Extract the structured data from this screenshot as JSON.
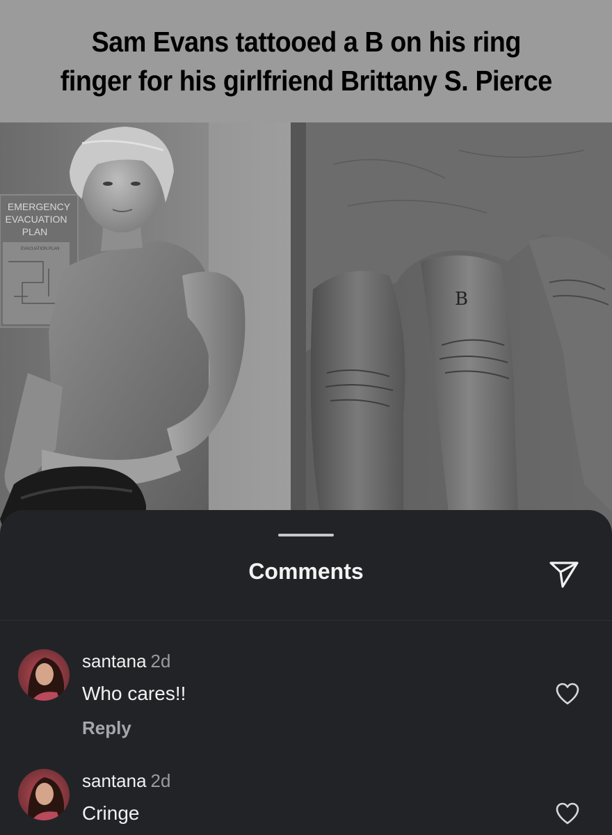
{
  "post": {
    "caption": [
      "Sam Evans tattooed a B on his ring",
      "finger for his girlfriend Brittany S. Pierce"
    ],
    "left_photo": {
      "sign_text": [
        "EMERGENCY",
        "EVACUATION",
        "PLAN"
      ],
      "sign_subtext": "EVACUATION PLAN"
    },
    "right_photo": {
      "tattoo_letter": "B"
    }
  },
  "comments_sheet": {
    "title": "Comments",
    "share_icon": "paper-plane-icon",
    "comments": [
      {
        "username": "santana",
        "time": "2d",
        "text": "Who cares!!",
        "reply_label": "Reply",
        "like_icon": "heart-outline-icon"
      },
      {
        "username": "santana",
        "time": "2d",
        "text": "Cringe",
        "like_icon": "heart-outline-icon"
      }
    ]
  },
  "colors": {
    "caption_bg": "#9b9b9b",
    "sheet_bg": "#222327",
    "text_primary": "#f2f2f2",
    "text_secondary": "#9a9ba0"
  }
}
